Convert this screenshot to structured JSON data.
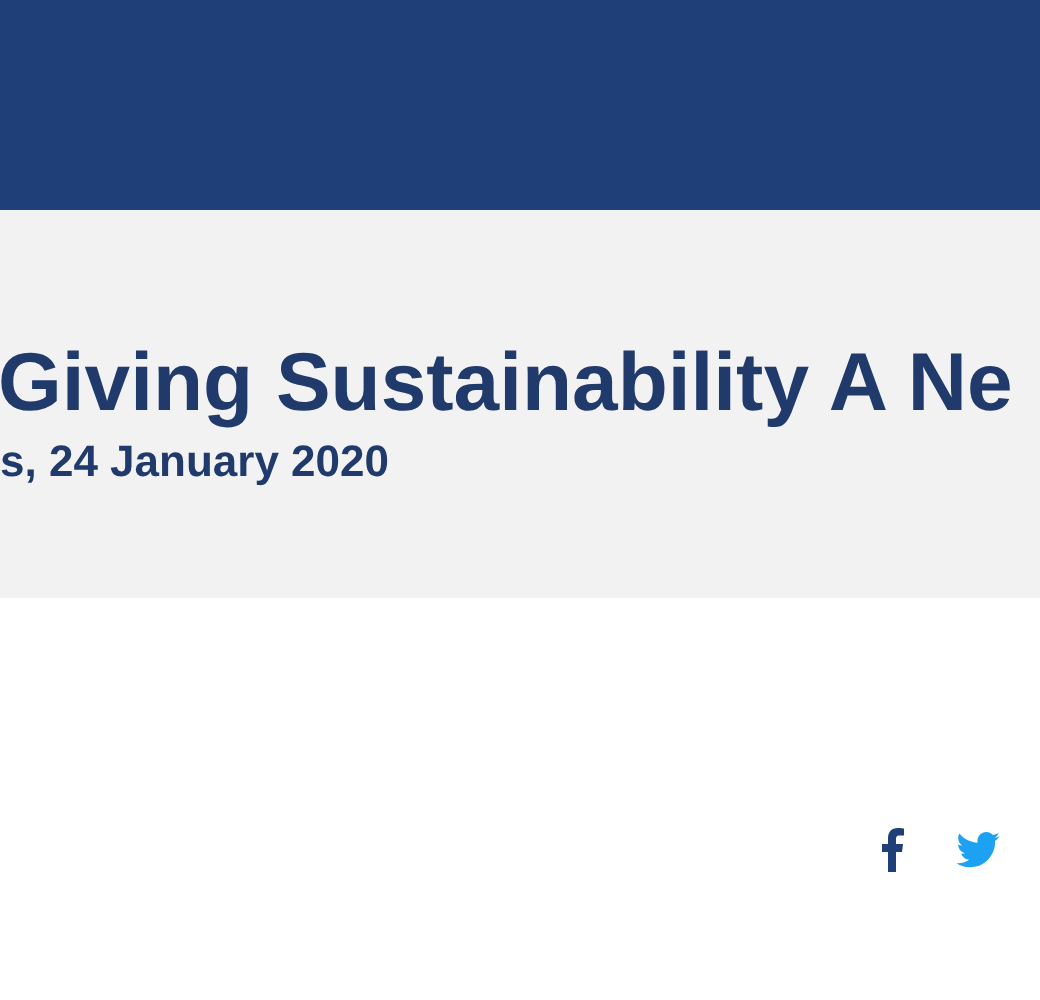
{
  "header": {
    "title": "Giving Sustainability A Ne",
    "subtitle": "s, 24 January 2020"
  },
  "share": [
    {
      "kind": "facebook"
    },
    {
      "kind": "twitter"
    }
  ]
}
